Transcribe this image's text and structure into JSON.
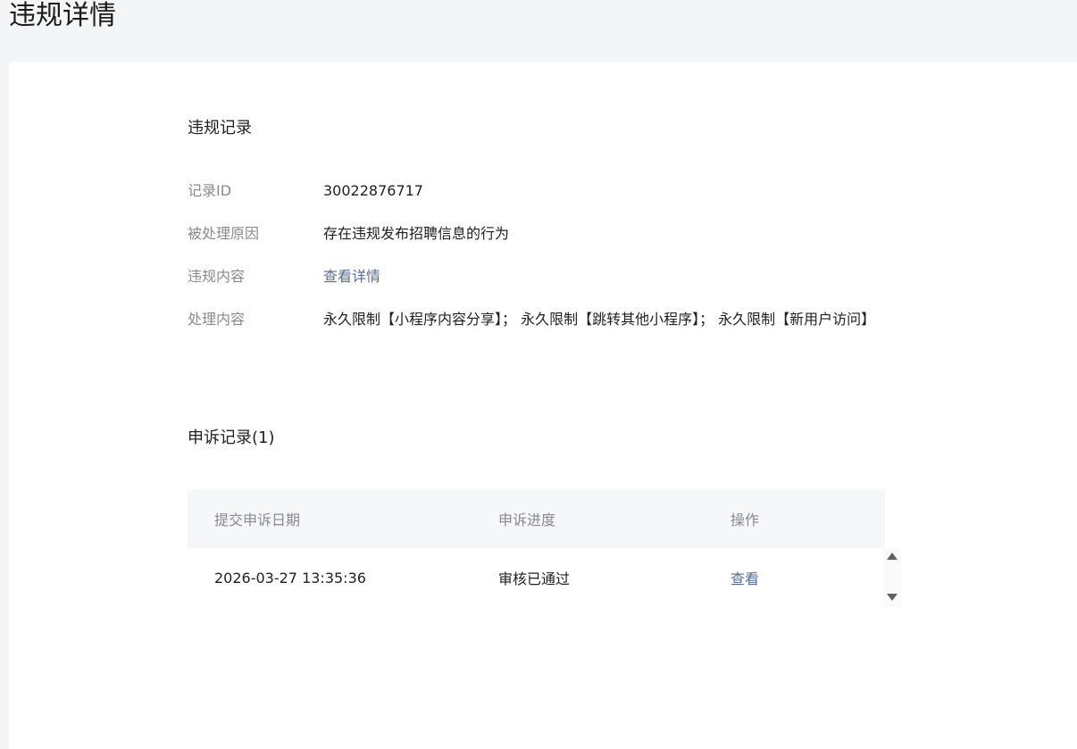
{
  "page": {
    "title": "违规详情"
  },
  "violation": {
    "section_title": "违规记录",
    "fields": {
      "record_id_label": "记录ID",
      "record_id_value": "30022876717",
      "reason_label": "被处理原因",
      "reason_value": "存在违规发布招聘信息的行为",
      "content_label": "违规内容",
      "content_link": "查看详情",
      "handling_label": "处理内容",
      "handling_value": "永久限制【小程序内容分享】； 永久限制【跳转其他小程序】； 永久限制【新用户访问】"
    }
  },
  "appeal": {
    "section_title": "申诉记录(1)",
    "columns": [
      "提交申诉日期",
      "申诉进度",
      "操作"
    ],
    "rows": [
      {
        "date": "2026-03-27 13:35:36",
        "progress": "审核已通过",
        "action": "查看"
      }
    ]
  },
  "colors": {
    "page_background": "#f4f5f7",
    "card_background": "#ffffff",
    "label_gray": "#888a90",
    "link_blue": "#576b95",
    "table_header_bg": "#f6f7f9"
  }
}
